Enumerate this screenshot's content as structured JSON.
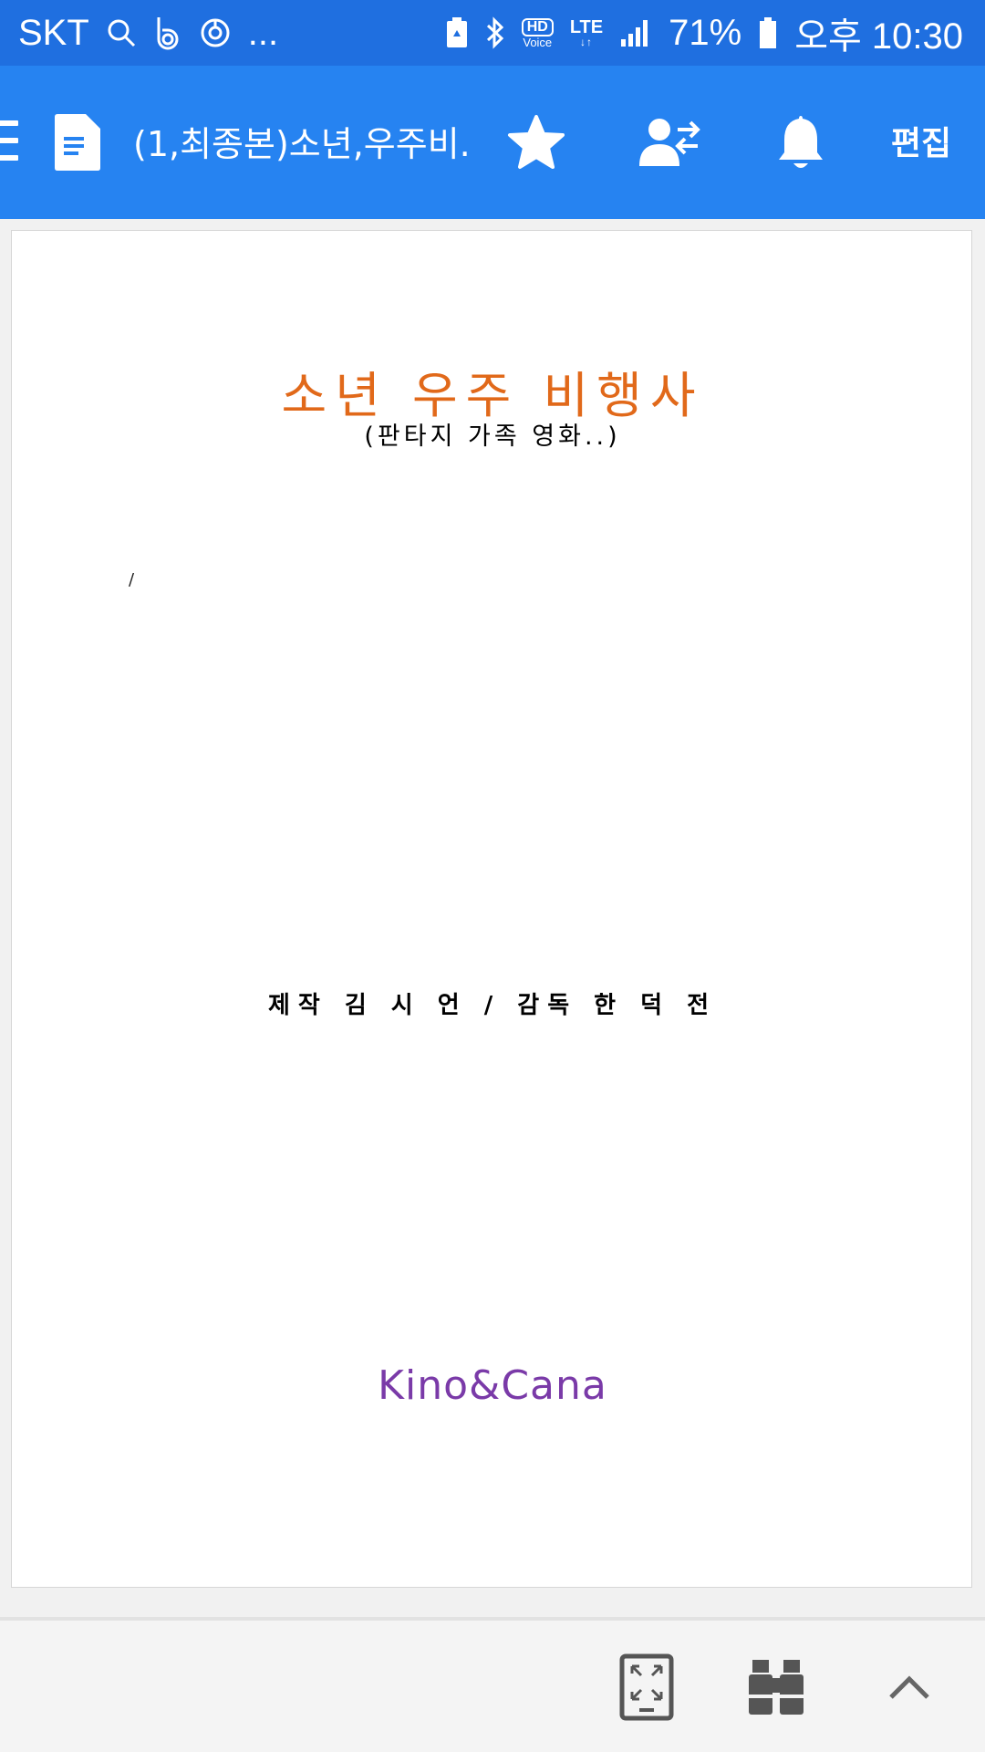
{
  "status_bar": {
    "carrier": "SKT",
    "dots": "...",
    "hd_label": "HD",
    "voice_label": "Voice",
    "network": "LTE",
    "battery_percent": "71%",
    "time": "오후 10:30"
  },
  "app_bar": {
    "document_title": "(1,최종본)소년,우주비...",
    "edit_label": "편집"
  },
  "document": {
    "title": "소년 우주 비행사",
    "subtitle": "(판타지 가족 영화..)",
    "stray_mark": "/",
    "credits": "제작 김 시 언 / 감독 한 덕 전",
    "company": "Kino&Cana",
    "colors": {
      "title": "#e1691a",
      "company": "#7a3aa8"
    }
  },
  "colors": {
    "status_bar": "#1f6fe0",
    "app_bar": "#2683f1"
  }
}
